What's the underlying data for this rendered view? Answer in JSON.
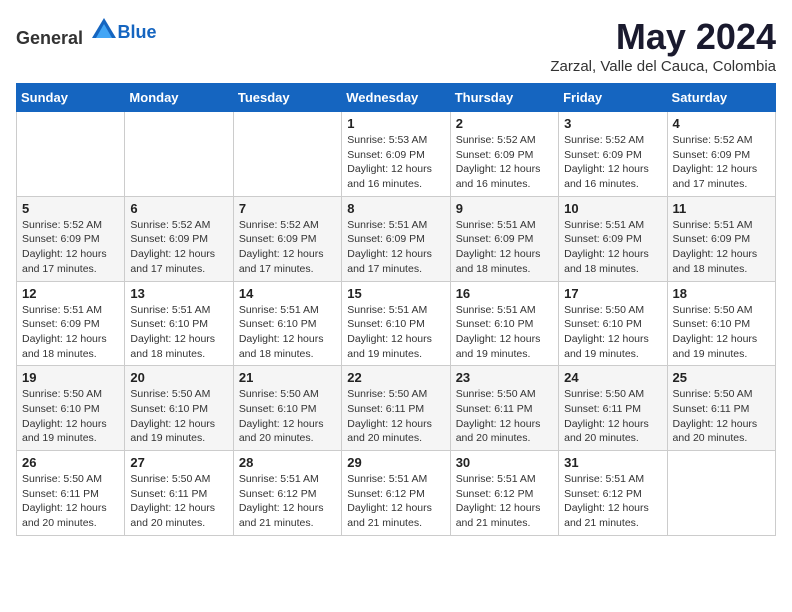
{
  "logo": {
    "general": "General",
    "blue": "Blue"
  },
  "title": "May 2024",
  "location": "Zarzal, Valle del Cauca, Colombia",
  "weekdays": [
    "Sunday",
    "Monday",
    "Tuesday",
    "Wednesday",
    "Thursday",
    "Friday",
    "Saturday"
  ],
  "weeks": [
    [
      {
        "day": "",
        "info": ""
      },
      {
        "day": "",
        "info": ""
      },
      {
        "day": "",
        "info": ""
      },
      {
        "day": "1",
        "info": "Sunrise: 5:53 AM\nSunset: 6:09 PM\nDaylight: 12 hours and 16 minutes."
      },
      {
        "day": "2",
        "info": "Sunrise: 5:52 AM\nSunset: 6:09 PM\nDaylight: 12 hours and 16 minutes."
      },
      {
        "day": "3",
        "info": "Sunrise: 5:52 AM\nSunset: 6:09 PM\nDaylight: 12 hours and 16 minutes."
      },
      {
        "day": "4",
        "info": "Sunrise: 5:52 AM\nSunset: 6:09 PM\nDaylight: 12 hours and 17 minutes."
      }
    ],
    [
      {
        "day": "5",
        "info": "Sunrise: 5:52 AM\nSunset: 6:09 PM\nDaylight: 12 hours and 17 minutes."
      },
      {
        "day": "6",
        "info": "Sunrise: 5:52 AM\nSunset: 6:09 PM\nDaylight: 12 hours and 17 minutes."
      },
      {
        "day": "7",
        "info": "Sunrise: 5:52 AM\nSunset: 6:09 PM\nDaylight: 12 hours and 17 minutes."
      },
      {
        "day": "8",
        "info": "Sunrise: 5:51 AM\nSunset: 6:09 PM\nDaylight: 12 hours and 17 minutes."
      },
      {
        "day": "9",
        "info": "Sunrise: 5:51 AM\nSunset: 6:09 PM\nDaylight: 12 hours and 18 minutes."
      },
      {
        "day": "10",
        "info": "Sunrise: 5:51 AM\nSunset: 6:09 PM\nDaylight: 12 hours and 18 minutes."
      },
      {
        "day": "11",
        "info": "Sunrise: 5:51 AM\nSunset: 6:09 PM\nDaylight: 12 hours and 18 minutes."
      }
    ],
    [
      {
        "day": "12",
        "info": "Sunrise: 5:51 AM\nSunset: 6:09 PM\nDaylight: 12 hours and 18 minutes."
      },
      {
        "day": "13",
        "info": "Sunrise: 5:51 AM\nSunset: 6:10 PM\nDaylight: 12 hours and 18 minutes."
      },
      {
        "day": "14",
        "info": "Sunrise: 5:51 AM\nSunset: 6:10 PM\nDaylight: 12 hours and 18 minutes."
      },
      {
        "day": "15",
        "info": "Sunrise: 5:51 AM\nSunset: 6:10 PM\nDaylight: 12 hours and 19 minutes."
      },
      {
        "day": "16",
        "info": "Sunrise: 5:51 AM\nSunset: 6:10 PM\nDaylight: 12 hours and 19 minutes."
      },
      {
        "day": "17",
        "info": "Sunrise: 5:50 AM\nSunset: 6:10 PM\nDaylight: 12 hours and 19 minutes."
      },
      {
        "day": "18",
        "info": "Sunrise: 5:50 AM\nSunset: 6:10 PM\nDaylight: 12 hours and 19 minutes."
      }
    ],
    [
      {
        "day": "19",
        "info": "Sunrise: 5:50 AM\nSunset: 6:10 PM\nDaylight: 12 hours and 19 minutes."
      },
      {
        "day": "20",
        "info": "Sunrise: 5:50 AM\nSunset: 6:10 PM\nDaylight: 12 hours and 19 minutes."
      },
      {
        "day": "21",
        "info": "Sunrise: 5:50 AM\nSunset: 6:10 PM\nDaylight: 12 hours and 20 minutes."
      },
      {
        "day": "22",
        "info": "Sunrise: 5:50 AM\nSunset: 6:11 PM\nDaylight: 12 hours and 20 minutes."
      },
      {
        "day": "23",
        "info": "Sunrise: 5:50 AM\nSunset: 6:11 PM\nDaylight: 12 hours and 20 minutes."
      },
      {
        "day": "24",
        "info": "Sunrise: 5:50 AM\nSunset: 6:11 PM\nDaylight: 12 hours and 20 minutes."
      },
      {
        "day": "25",
        "info": "Sunrise: 5:50 AM\nSunset: 6:11 PM\nDaylight: 12 hours and 20 minutes."
      }
    ],
    [
      {
        "day": "26",
        "info": "Sunrise: 5:50 AM\nSunset: 6:11 PM\nDaylight: 12 hours and 20 minutes."
      },
      {
        "day": "27",
        "info": "Sunrise: 5:50 AM\nSunset: 6:11 PM\nDaylight: 12 hours and 20 minutes."
      },
      {
        "day": "28",
        "info": "Sunrise: 5:51 AM\nSunset: 6:12 PM\nDaylight: 12 hours and 21 minutes."
      },
      {
        "day": "29",
        "info": "Sunrise: 5:51 AM\nSunset: 6:12 PM\nDaylight: 12 hours and 21 minutes."
      },
      {
        "day": "30",
        "info": "Sunrise: 5:51 AM\nSunset: 6:12 PM\nDaylight: 12 hours and 21 minutes."
      },
      {
        "day": "31",
        "info": "Sunrise: 5:51 AM\nSunset: 6:12 PM\nDaylight: 12 hours and 21 minutes."
      },
      {
        "day": "",
        "info": ""
      }
    ]
  ]
}
